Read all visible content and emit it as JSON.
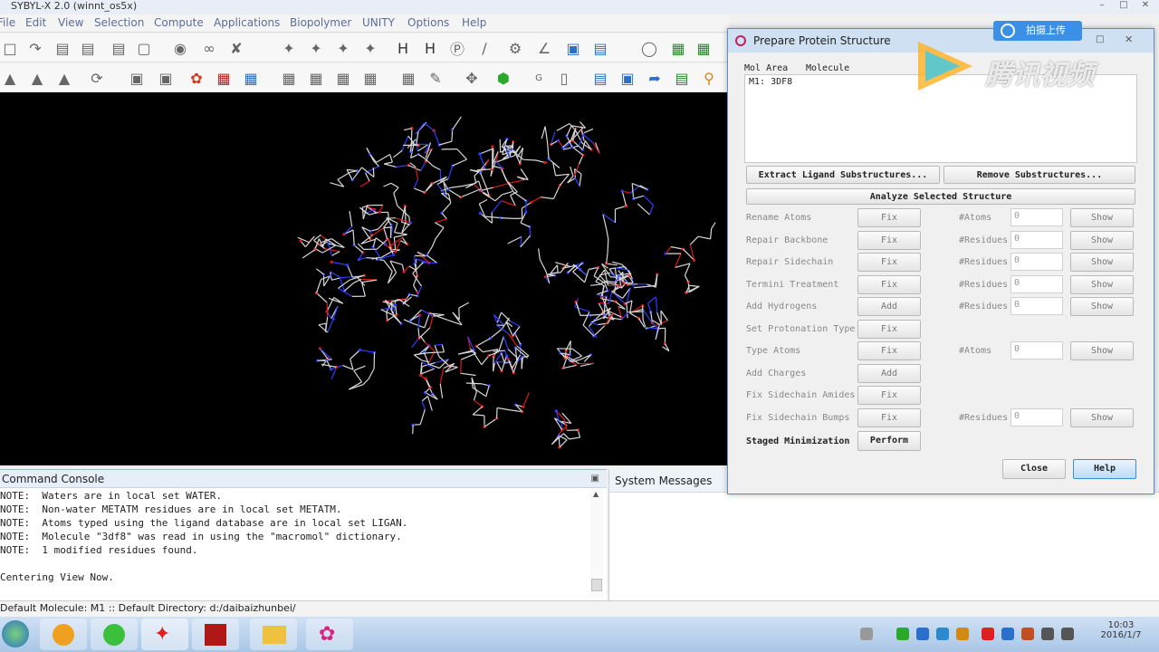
{
  "window": {
    "title": "SYBYL-X 2.0 (winnt_os5x)"
  },
  "menu": [
    "File",
    "Edit",
    "View",
    "Selection",
    "Compute",
    "Applications",
    "Biopolymer",
    "UNITY",
    "Options",
    "Help"
  ],
  "console": {
    "title": "Command Console",
    "lines": [
      "NOTE:  Waters are in local set WATER.",
      "NOTE:  Non-water METATM residues are in local set METATM.",
      "NOTE:  Atoms typed using the ligand database are in local set LIGAN.",
      "NOTE:  Molecule \"3df8\" was read in using the \"macromol\" dictionary.",
      "NOTE:  1 modified residues found.",
      "",
      "Centering View Now."
    ]
  },
  "system_messages": {
    "title": "System Messages"
  },
  "statusbar": {
    "text": "Default Molecule: M1 :: Default Directory: d:/daibaizhunbei/"
  },
  "dialog": {
    "title": "Prepare Protein Structure",
    "list_headers": {
      "area": "Mol Area",
      "molecule": "Molecule"
    },
    "list_item": "M1: 3DF8",
    "extract_button": "Extract Ligand Substructures...",
    "remove_button": "Remove Substructures...",
    "analyze_button": "Analyze Selected Structure",
    "rows": [
      {
        "label": "Rename Atoms",
        "action": "Fix",
        "count_label": "#Atoms",
        "count": "0",
        "show": "Show"
      },
      {
        "label": "Repair Backbone",
        "action": "Fix",
        "count_label": "#Residues",
        "count": "0",
        "show": "Show"
      },
      {
        "label": "Repair Sidechain",
        "action": "Fix",
        "count_label": "#Residues",
        "count": "0",
        "show": "Show"
      },
      {
        "label": "Termini Treatment",
        "action": "Fix",
        "count_label": "#Residues",
        "count": "0",
        "show": "Show"
      },
      {
        "label": "Add Hydrogens",
        "action": "Add",
        "count_label": "#Residues",
        "count": "0",
        "show": "Show"
      },
      {
        "label": "Set Protonation Type",
        "action": "Fix",
        "count_label": "",
        "count": "",
        "show": ""
      },
      {
        "label": "Type Atoms",
        "action": "Fix",
        "count_label": "#Atoms",
        "count": "0",
        "show": "Show"
      },
      {
        "label": "Add Charges",
        "action": "Add",
        "count_label": "",
        "count": "",
        "show": ""
      },
      {
        "label": "Fix Sidechain Amides",
        "action": "Fix",
        "count_label": "",
        "count": "",
        "show": ""
      },
      {
        "label": "Fix Sidechain Bumps",
        "action": "Fix",
        "count_label": "#Residues",
        "count": "0",
        "show": "Show"
      }
    ],
    "staged_label": "Staged Minimization",
    "perform_button": "Perform",
    "close_button": "Close",
    "help_button": "Help"
  },
  "overlay": {
    "button": "拍摄上传",
    "brand": "腾讯视频"
  },
  "clock": {
    "time": "10:03",
    "date": "2016/1/7"
  },
  "colors": {
    "viewport_bg": "#000000",
    "carbon": "#d8d8d8",
    "nitrogen": "#2b3fff",
    "oxygen": "#e01818"
  }
}
